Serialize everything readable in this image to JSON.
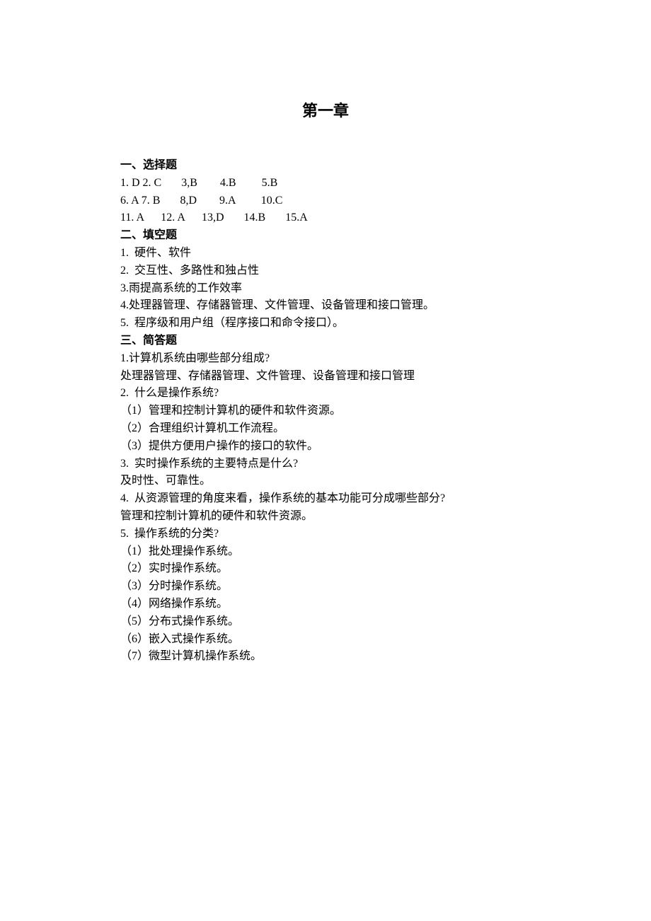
{
  "title": "第一章",
  "sections": [
    {
      "heading": "一、选择题",
      "lines": [
        "1. D 2. C       3,B        4.B         5.B",
        "6. A 7. B       8,D        9.A         10.C",
        "11. A      12. A      13,D       14.B       15.A"
      ]
    },
    {
      "heading": "二、填空题",
      "lines": [
        "1.  硬件、软件",
        "2.  交互性、多路性和独占性",
        "3.雨提高系统的工作效率",
        "4.处理器管理、存储器管理、文件管理、设备管理和接口管理。",
        "5.  程序级和用户组（程序接口和命令接口）。"
      ]
    },
    {
      "heading": "三、简答题",
      "lines": [
        "1.计算机系统由哪些部分组成?",
        "处理器管理、存储器管理、文件管理、设备管理和接口管理",
        "2.  什么是操作系统?",
        "（1）管理和控制计算机的硬件和软件资源。",
        "（2）合理组织计算机工作流程。",
        "（3）提供方便用户操作的接口的软件。",
        "3.  实时操作系统的主要特点是什么?",
        "及时性、可靠性。",
        "4.  从资源管理的角度来看，操作系统的基本功能可分成哪些部分?",
        "管理和控制计算机的硬件和软件资源。",
        "5.  操作系统的分类?",
        "（1）批处理操作系统。",
        "（2）实时操作系统。",
        "（3）分时操作系统。",
        "（4）网络操作系统。",
        "（5）分布式操作系统。",
        "（6）嵌入式操作系统。",
        "（7）微型计算机操作系统。"
      ]
    }
  ]
}
